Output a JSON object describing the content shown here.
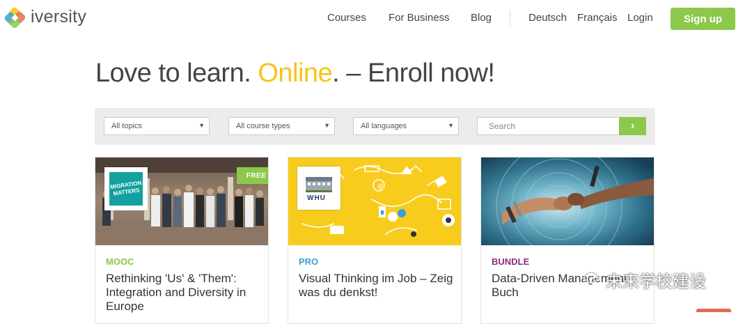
{
  "header": {
    "brand": "iversity",
    "nav": [
      "Courses",
      "For Business",
      "Blog"
    ],
    "lang": [
      "Deutsch",
      "Français"
    ],
    "login": "Login",
    "signup": "Sign up"
  },
  "hero": {
    "part1": "Love to learn. ",
    "highlight": "Online",
    "part2": ". – Enroll now!"
  },
  "filters": {
    "topics": "All topics",
    "course_types": "All course types",
    "languages": "All languages",
    "search_placeholder": "Search",
    "caret": "▼",
    "search_button": "›"
  },
  "cards": [
    {
      "type": "MOOC",
      "type_color": "#8cc84b",
      "title": "Rethinking 'Us' & 'Them': Integration and Diversity in Europe",
      "logo": "MIGRATION MATTERS",
      "badge": "FREE"
    },
    {
      "type": "PRO",
      "type_color": "#3aa0d8",
      "title": "Visual Thinking im Job – Zeig was du denkst!",
      "logo": "WHU"
    },
    {
      "type": "BUNDLE",
      "type_color": "#8e2c7e",
      "title": "Data-Driven Management Buch"
    }
  ],
  "watermark": "未来学校建设"
}
